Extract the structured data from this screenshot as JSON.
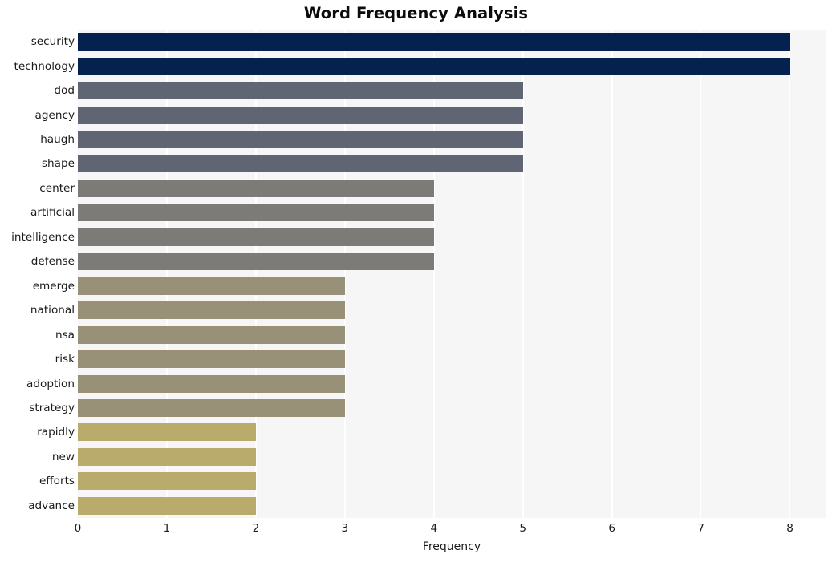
{
  "chart_data": {
    "type": "bar",
    "orientation": "horizontal",
    "title": "Word Frequency Analysis",
    "xlabel": "Frequency",
    "ylabel": "",
    "categories": [
      "security",
      "technology",
      "dod",
      "agency",
      "haugh",
      "shape",
      "center",
      "artificial",
      "intelligence",
      "defense",
      "emerge",
      "national",
      "nsa",
      "risk",
      "adoption",
      "strategy",
      "rapidly",
      "new",
      "efforts",
      "advance"
    ],
    "values": [
      8,
      8,
      5,
      5,
      5,
      5,
      4,
      4,
      4,
      4,
      3,
      3,
      3,
      3,
      3,
      3,
      2,
      2,
      2,
      2
    ],
    "xlim": [
      0,
      8.4
    ],
    "xticks": [
      0,
      1,
      2,
      3,
      4,
      5,
      6,
      7,
      8
    ],
    "xtick_labels": [
      "0",
      "1",
      "2",
      "3",
      "4",
      "5",
      "6",
      "7",
      "8"
    ],
    "grid": "x-only-white",
    "legend": "none",
    "bar_colors": [
      "#05224f",
      "#05224f",
      "#5f6573",
      "#5f6573",
      "#5f6573",
      "#5f6573",
      "#7c7b77",
      "#7c7b77",
      "#7c7b77",
      "#7c7b77",
      "#989077",
      "#989077",
      "#989077",
      "#989077",
      "#989077",
      "#989077",
      "#b8ab6b",
      "#b8ab6b",
      "#b8ab6b",
      "#b8ab6b"
    ],
    "palette": {
      "navy": "#05224f",
      "slate": "#5f6573",
      "gray": "#7c7b77",
      "dark_khaki": "#989077",
      "light_khaki": "#b8ab6b"
    },
    "plot_background": "#f6f6f7",
    "gridline_color": "#ffffff",
    "figure_background": "#ffffff",
    "text_color": "#1a1a1a"
  }
}
